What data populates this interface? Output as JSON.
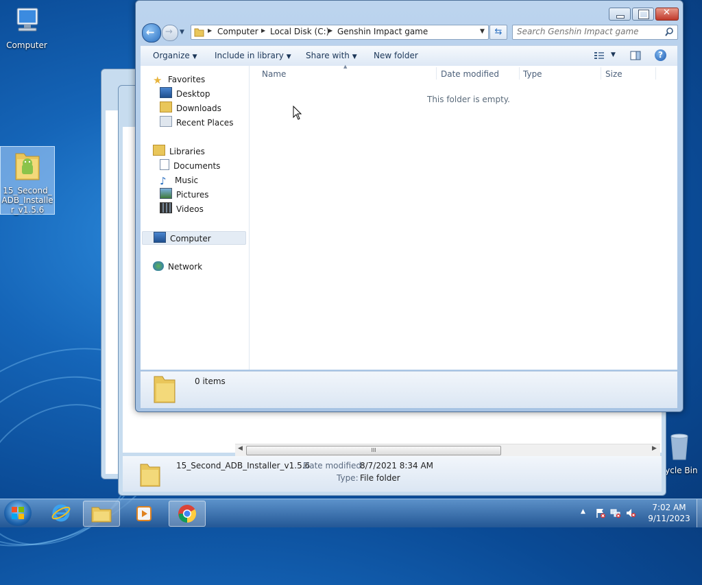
{
  "desktop": {
    "icons": [
      {
        "label": "Computer"
      },
      {
        "label": "15_Second_ADB_Installer_v1.5.6"
      },
      {
        "label": "Recycle Bin"
      }
    ]
  },
  "bg_window": {
    "details": {
      "name": "15_Second_ADB_Installer_v1.5.6",
      "date_label": "Date modified:",
      "date_value": "8/7/2021 8:34 AM",
      "type_label": "Type:",
      "type_value": "File folder"
    },
    "scroll_grip": "III"
  },
  "explorer": {
    "breadcrumb": [
      "Computer",
      "Local Disk (C:)",
      "Genshin Impact game"
    ],
    "search_placeholder": "Search Genshin Impact game",
    "toolbar": {
      "organize": "Organize",
      "include_in_library": "Include in library",
      "share_with": "Share with",
      "new_folder": "New folder"
    },
    "nav": {
      "favorites": "Favorites",
      "desktop": "Desktop",
      "downloads": "Downloads",
      "recent_places": "Recent Places",
      "libraries": "Libraries",
      "documents": "Documents",
      "music": "Music",
      "pictures": "Pictures",
      "videos": "Videos",
      "computer": "Computer",
      "network": "Network"
    },
    "columns": {
      "name": "Name",
      "date_modified": "Date modified",
      "type": "Type",
      "size": "Size"
    },
    "empty_message": "This folder is empty.",
    "status": "0 items"
  },
  "taskbar": {
    "time": "7:02 AM",
    "date": "9/11/2023",
    "tray_arrow": "▲"
  },
  "colors": {
    "accent": "#1f5fa8",
    "selection": "#cde3f8"
  }
}
